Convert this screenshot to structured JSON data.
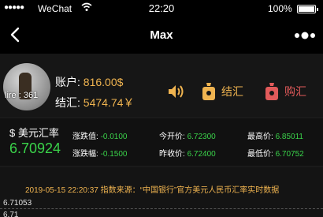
{
  "status_bar": {
    "signal": "●●●●●",
    "carrier": "WeChat",
    "time": "22:20",
    "battery": "100%"
  },
  "nav": {
    "title": "Max"
  },
  "account": {
    "avatar_label": "lire : 361",
    "balance_label": "账户:",
    "balance_value": "816.00$",
    "settle_label": "结汇:",
    "settle_value": "5474.74￥",
    "settle_button": "结汇",
    "buy_button": "购汇"
  },
  "quote": {
    "name": "美元汇率",
    "currency_symbol": "$",
    "rate": "6.70924",
    "change_label": "涨跌值:",
    "change_value": "-0.0100",
    "change_pct_label": "涨跌幅:",
    "change_pct_value": "-0.1500",
    "open_label": "今开价:",
    "open_value": "6.72300",
    "prev_close_label": "昨收价:",
    "prev_close_value": "6.72400",
    "high_label": "最高价:",
    "high_value": "6.85011",
    "low_label": "最低价:",
    "low_value": "6.70752"
  },
  "chart": {
    "info": "2019-05-15 22:20:37  指数来源：“中国银行”官方美元人民币汇率实时数据",
    "y_ticks": [
      "6.71053",
      "6.71"
    ]
  },
  "colors": {
    "gold": "#f0b450",
    "green": "#3ad34a",
    "red": "#e25a5a",
    "background": "#1a1a1a"
  }
}
